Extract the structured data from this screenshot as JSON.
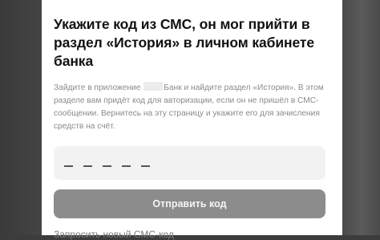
{
  "modal": {
    "title": "Укажите код из СМС, он мог прийти в раздел «История» в личном кабинете банка",
    "description_before": "Зайдите в приложение",
    "description_after": "Банк и найдите раздел «История». В этом разделе вам придёт код для авторизации, если он не пришёл в СМС-сообщении. Вернитесь на эту страницу и укажите его для зачисления средств на счёт.",
    "code_input": {
      "placeholder_glyph": "_",
      "length": 5
    },
    "submit_label": "Отправить код",
    "resend_label": "Запросить новый СМС-код"
  }
}
